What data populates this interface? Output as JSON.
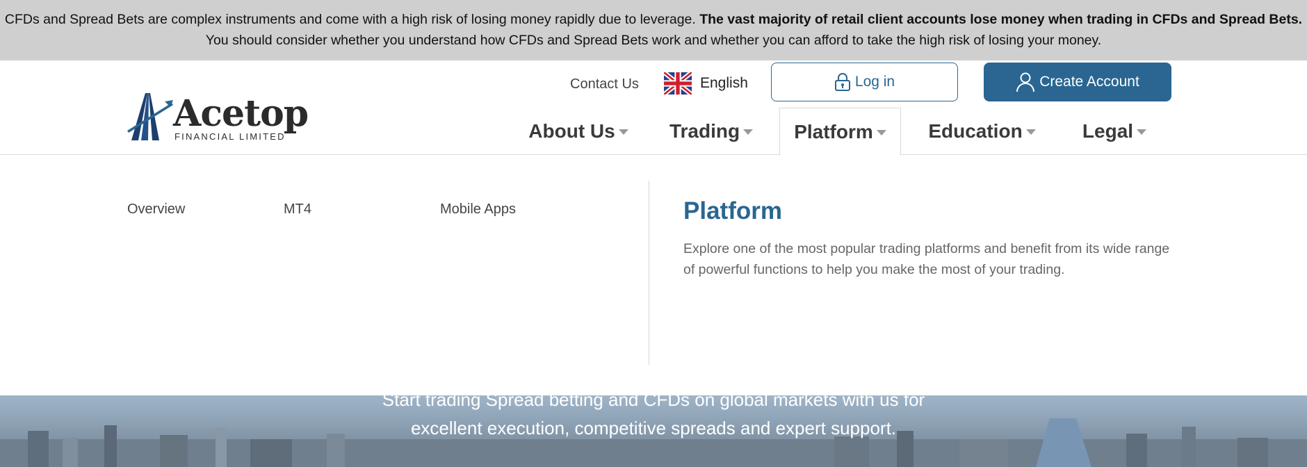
{
  "risk_warning": {
    "part1": "CFDs and Spread Bets are complex instruments and come with a high risk of losing money rapidly due to leverage. ",
    "bold": "The vast majority of retail client accounts lose money when trading in CFDs and Spread Bets.",
    "part2": " You should consider whether you understand how CFDs and Spread Bets work and whether you can afford to take the high risk of losing your money."
  },
  "logo": {
    "name": "Acetop",
    "subtitle": "FINANCIAL LIMITED"
  },
  "top_links": {
    "contact": "Contact Us",
    "language": "English",
    "login": "Log in",
    "create_account": "Create Account"
  },
  "nav": {
    "items": [
      {
        "label": "About Us"
      },
      {
        "label": "Trading"
      },
      {
        "label": "Platform"
      },
      {
        "label": "Education"
      },
      {
        "label": "Legal"
      }
    ],
    "active": "Platform"
  },
  "dropdown": {
    "links": [
      "Overview",
      "MT4",
      "Mobile Apps"
    ],
    "title": "Platform",
    "description": "Explore one of the most popular trading platforms and benefit from its wide range of powerful functions to help you make the most of your trading."
  },
  "hero": {
    "text": "Start trading Spread betting and CFDs on global markets with us for excellent execution, competitive spreads and expert support."
  },
  "colors": {
    "brand_blue": "#2a6691",
    "banner_grey": "#cfcfcf"
  },
  "icons": {
    "language_flag": "uk-flag-icon",
    "login": "lock-icon",
    "create_account": "user-icon",
    "nav_caret": "caret-down-icon"
  }
}
